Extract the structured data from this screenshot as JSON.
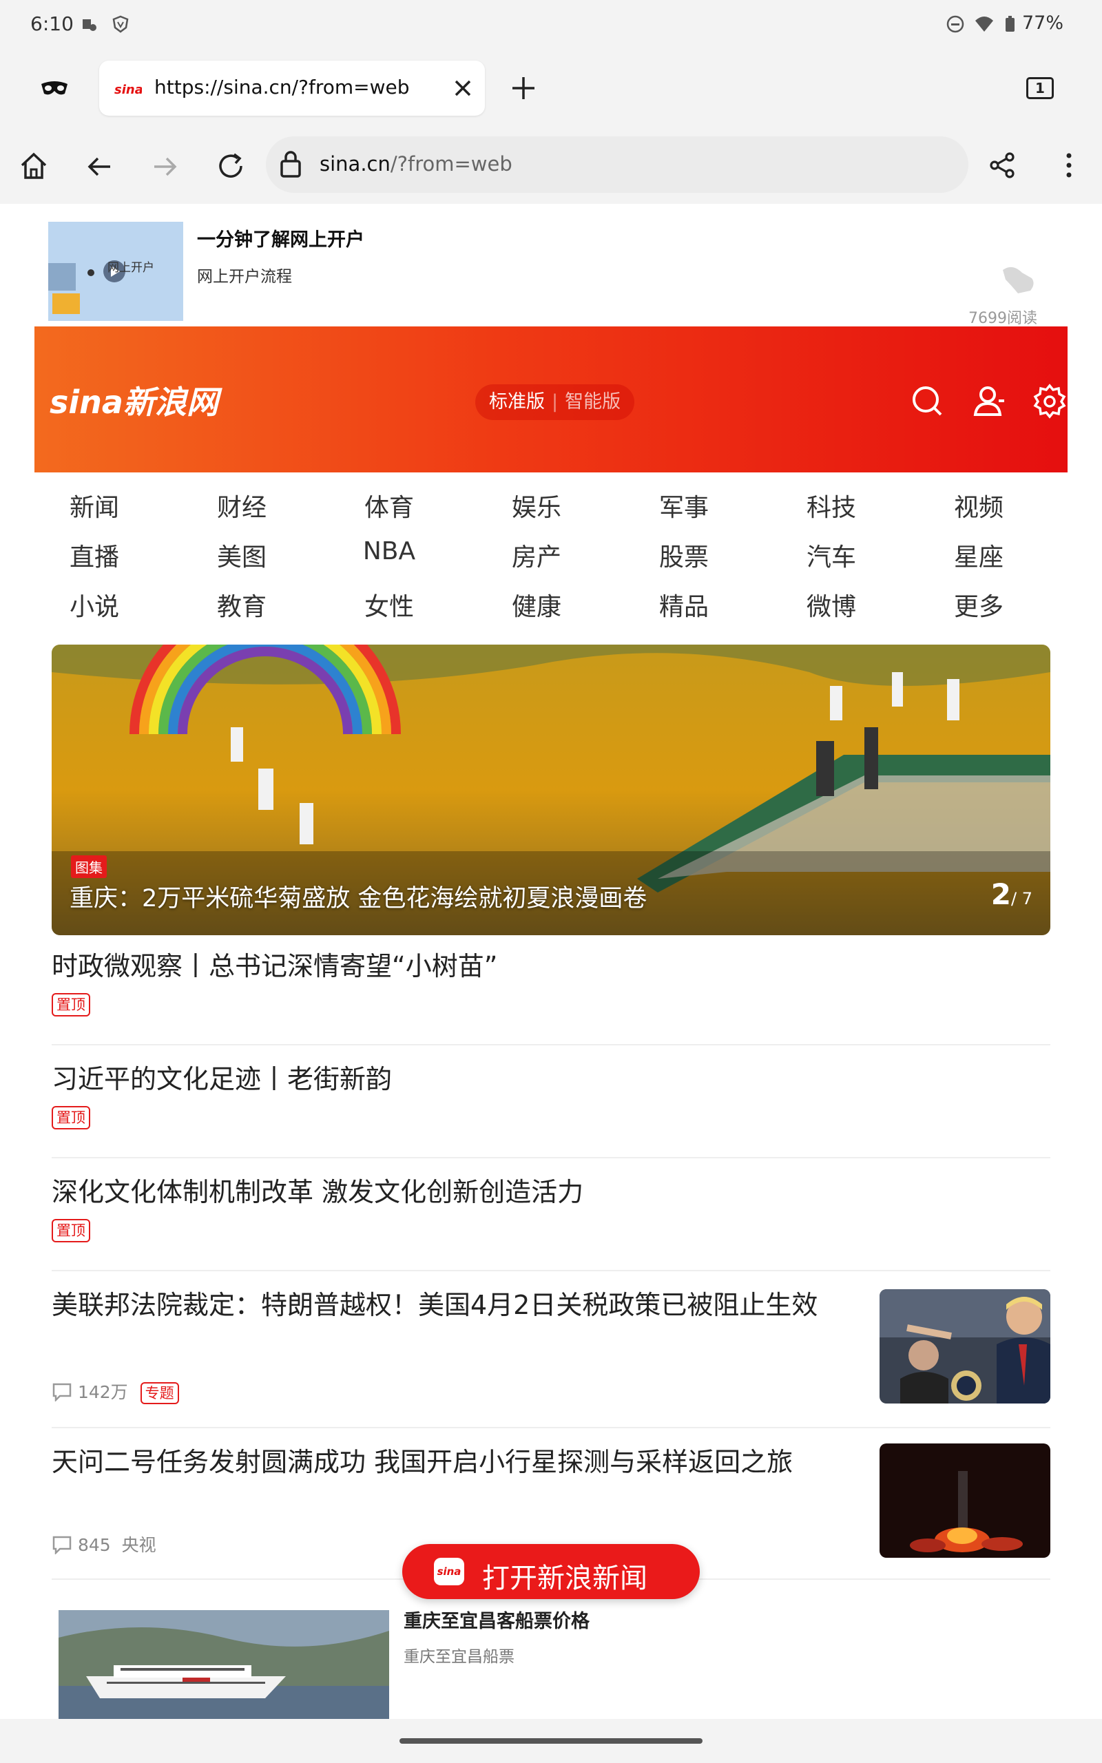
{
  "status_bar": {
    "time": "6:10",
    "battery": "77%"
  },
  "browser": {
    "tab_url": "https://sina.cn/?from=web",
    "tab_count": "1",
    "address_host": "sina.cn",
    "address_path": "/?from=web"
  },
  "ad_top": {
    "title": "一分钟了解网上开户",
    "subtitle": "网上开户流程",
    "thumb_text": "网上开户",
    "reads": "7699阅读"
  },
  "header": {
    "logo": "sina新浪网",
    "mode_standard": "标准版",
    "mode_sep": "|",
    "mode_smart": "智能版"
  },
  "channels": [
    "新闻",
    "财经",
    "体育",
    "娱乐",
    "军事",
    "科技",
    "视频",
    "直播",
    "美图",
    "NBA",
    "房产",
    "股票",
    "汽车",
    "星座",
    "小说",
    "教育",
    "女性",
    "健康",
    "精品",
    "微博",
    "更多"
  ],
  "hero": {
    "badge": "图集",
    "caption": "重庆：2万平米硫华菊盛放 金色花海绘就初夏浪漫画卷",
    "page": "2",
    "total": "/ 7"
  },
  "news": [
    {
      "headline": "时政微观察丨总书记深情寄望“小树苗”",
      "tag": "置顶"
    },
    {
      "headline": "习近平的文化足迹丨老街新韵",
      "tag": "置顶"
    },
    {
      "headline": "深化文化体制机制改革 激发文化创新创造活力",
      "tag": "置顶"
    },
    {
      "headline": "美联邦法院裁定：特朗普越权！美国4月2日关税政策已被阻止生效",
      "comments": "142万",
      "tag": "专题"
    },
    {
      "headline": "天问二号任务发射圆满成功 我国开启小行星探测与采样返回之旅",
      "comments": "845",
      "source": "央视"
    }
  ],
  "ad_bottom": {
    "title": "重庆至宜昌客船票价格",
    "subtitle": "重庆至宜昌船票"
  },
  "open_app": {
    "label": "打开新浪新闻",
    "icon_text": "sina"
  },
  "colors": {
    "brand_red": "#e50f0f",
    "brand_orange": "#f36a1e",
    "tag_red": "#e41b1b"
  }
}
